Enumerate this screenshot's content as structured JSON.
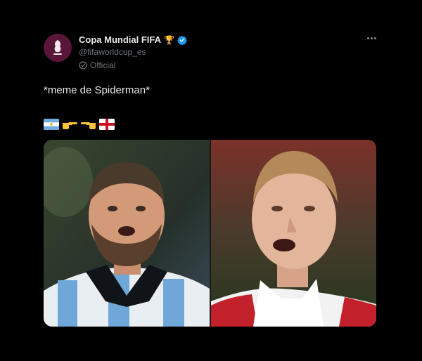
{
  "tweet": {
    "author": {
      "display_name": "Copa Mundial FIFA",
      "handle": "@fifaworldcup_es",
      "official_label": "Official",
      "avatar_icon": "fifa-world-cup-qatar-logo",
      "trophy_icon": "trophy-emoji",
      "verified_icon": "verified-badge"
    },
    "more_icon": "more-options-icon",
    "text": "*meme de Spiderman*",
    "emoji": [
      "flag-argentina",
      "pointing-right-hand",
      "pointing-left-hand",
      "flag-england"
    ],
    "media": [
      {
        "description_icon": "player-photo-argentina"
      },
      {
        "description_icon": "player-photo-england"
      }
    ]
  },
  "colors": {
    "background": "#000000",
    "text_primary": "#e7e9ea",
    "text_secondary": "#71767b",
    "verified_blue": "#1d9bf0",
    "avatar_maroon": "#5a1638"
  }
}
